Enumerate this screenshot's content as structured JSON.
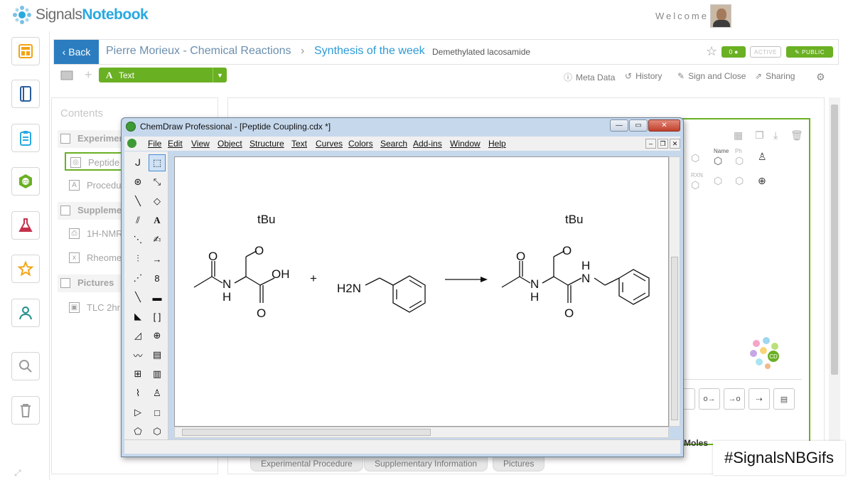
{
  "app": {
    "logo_part1": "Signals",
    "logo_part2": "Notebook",
    "welcome": "Welcome"
  },
  "header": {
    "back_label": "Back",
    "breadcrumb_parent": "Pierre Morieux - Chemical Reactions",
    "breadcrumb_current": "Synthesis of the week",
    "breadcrumb_subtitle": "Demethylated lacosamide",
    "comment_count": "0",
    "status_active": "ACTIVE",
    "status_public": "PUBLIC"
  },
  "toolbar": {
    "text_dropdown_label": "Text",
    "meta_data": "Meta Data",
    "history": "History",
    "sign_close": "Sign and Close",
    "sharing": "Sharing"
  },
  "contents": {
    "title": "Contents",
    "sections": [
      {
        "label": "Experimen"
      },
      {
        "label": "Suppleme"
      },
      {
        "label": "Pictures"
      }
    ],
    "items": [
      {
        "label": "Peptide"
      },
      {
        "label": "Procedu"
      },
      {
        "label": "1H-NMR"
      },
      {
        "label": "Rheome"
      },
      {
        "label": "TLC 2hr"
      }
    ]
  },
  "chemdraw": {
    "title": "ChemDraw Professional - [Peptide Coupling.cdx *]",
    "menus": [
      "File",
      "Edit",
      "View",
      "Object",
      "Structure",
      "Text",
      "Curves",
      "Colors",
      "Search",
      "Add-ins",
      "Window",
      "Help"
    ],
    "atom_labels": {
      "tBu_left": "tBu",
      "O_left_ether": "O",
      "O_left_acetyl": "O",
      "N_left": "N",
      "H_left": "H",
      "OH": "OH",
      "O_acid": "O",
      "plus": "+",
      "H2N": "H2N",
      "tBu_right": "tBu",
      "O_right_ether": "O",
      "O_right_acetyl": "O",
      "N_right1": "N",
      "H_right1": "H",
      "N_right2": "N",
      "H_right2": "H",
      "O_amide": "O"
    }
  },
  "embed_panel": {
    "name_label": "Name",
    "ph_label": "Ph",
    "rxn_label": "RXN",
    "moles_label": "Moles"
  },
  "bottom_tabs": [
    "Experimental Procedure",
    "Supplementary Information",
    "Pictures"
  ],
  "overlay": {
    "hashtag": "#SignalsNBGifs"
  },
  "colors": {
    "brand_blue": "#2b7dc0",
    "accent_green": "#6ab023",
    "logo_blue": "#28a9e0"
  }
}
